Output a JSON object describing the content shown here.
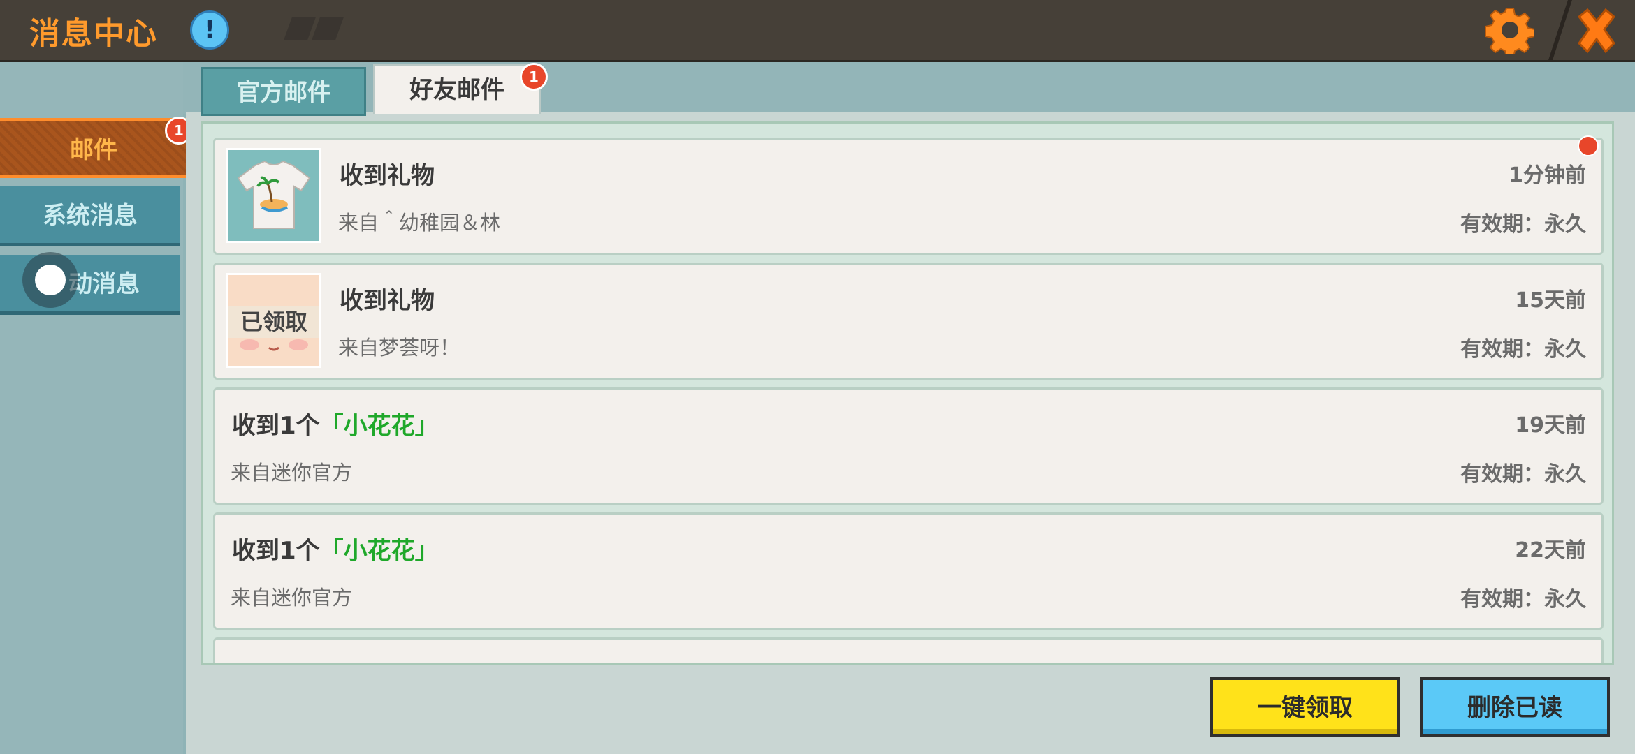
{
  "header": {
    "title": "消息中心",
    "info_icon_glyph": "!"
  },
  "sidebar": {
    "items": [
      {
        "label": "邮件",
        "badge": "1",
        "active": true
      },
      {
        "label": "系统消息"
      },
      {
        "label": "动消息"
      }
    ]
  },
  "tabs": [
    {
      "label": "官方邮件"
    },
    {
      "label": "好友邮件",
      "badge": "1",
      "active": true
    }
  ],
  "messages": [
    {
      "title": "收到礼物",
      "from": "来自＾幼稚园＆林",
      "time": "1分钟前",
      "validity": "有效期：永久",
      "unread": true,
      "thumb": "t-shirt-gift"
    },
    {
      "title": "收到礼物",
      "from": "来自梦荟呀！",
      "time": "15天前",
      "validity": "有效期：永久",
      "claimed_label": "已领取",
      "thumb": "face-gift"
    },
    {
      "title_prefix": "收到1个",
      "title_item": "「小花花」",
      "from": "来自迷你官方",
      "time": "19天前",
      "validity": "有效期：永久"
    },
    {
      "title_prefix": "收到1个",
      "title_item": "「小花花」",
      "from": "来自迷你官方",
      "time": "22天前",
      "validity": "有效期：永久"
    }
  ],
  "buttons": {
    "claim_all": "一键领取",
    "delete_read": "删除已读"
  },
  "colors": {
    "accent_orange": "#ff9a2c",
    "item_green": "#1fa82a",
    "badge_red": "#e8462a",
    "claim_yellow": "#ffe21a",
    "delete_blue": "#5bc9f7"
  }
}
